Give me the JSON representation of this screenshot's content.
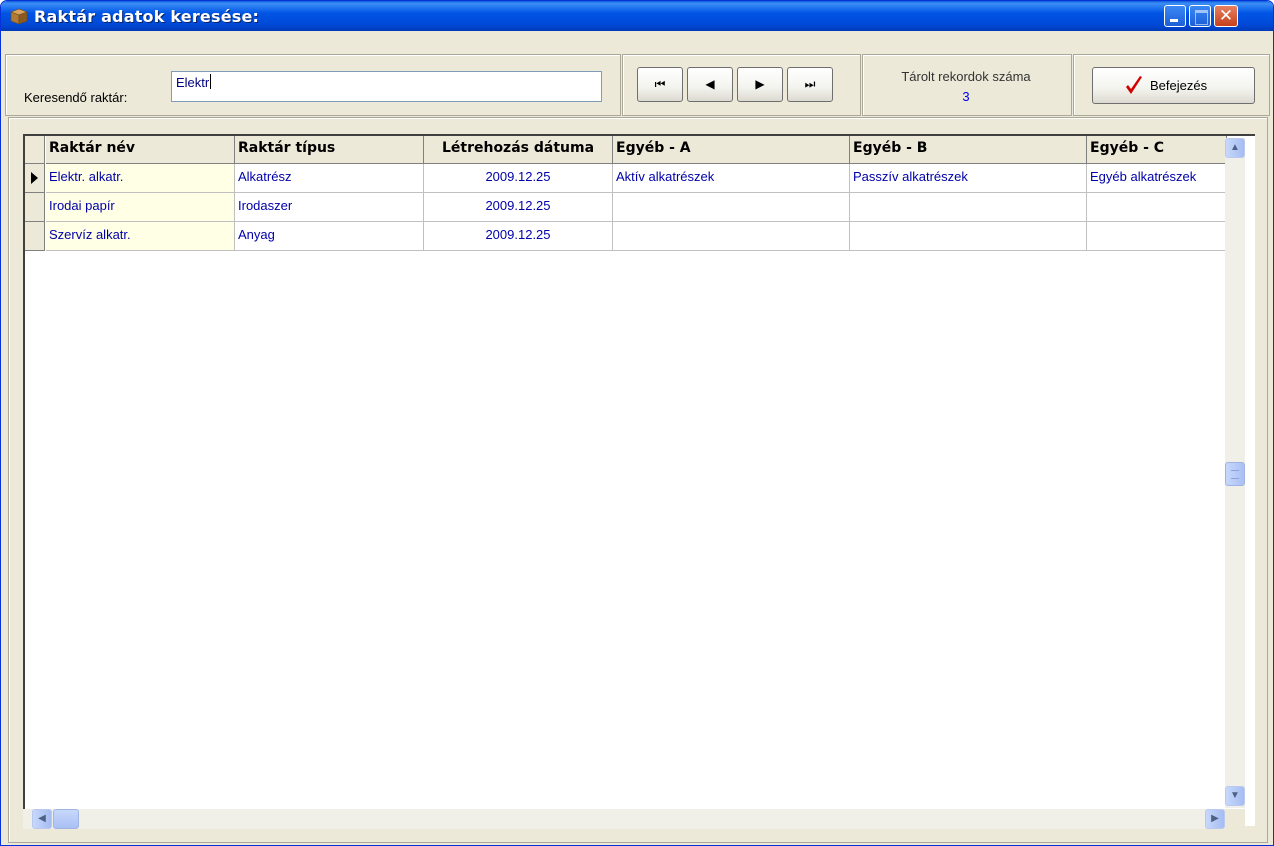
{
  "window": {
    "title": "Raktár adatok keresése:",
    "icon": "box-icon"
  },
  "search": {
    "label": "Keresendő raktár:",
    "value": "Elektr"
  },
  "nav": {
    "first_label": "⏮",
    "prev_label": "◀",
    "next_label": "▶",
    "last_label": "⏭"
  },
  "count": {
    "label": "Tárolt rekordok száma",
    "value": "3"
  },
  "exit": {
    "label": "Befejezés",
    "icon": "checkmark-icon"
  },
  "grid": {
    "columns": [
      "Raktár név",
      "Raktár típus",
      "Létrehozás dátuma",
      "Egyéb - A",
      "Egyéb - B",
      "Egyéb - C"
    ],
    "rows": [
      [
        "Elektr. alkatr.",
        "Alkatrész",
        "2009.12.25",
        "Aktív alkatrészek",
        "Passzív alkatrészek",
        "Egyéb alkatrészek"
      ],
      [
        "Irodai papír",
        "Irodaszer",
        "2009.12.25",
        "",
        "",
        ""
      ],
      [
        "Szervíz alkatr.",
        "Anyag",
        "2009.12.25",
        "",
        "",
        ""
      ]
    ]
  },
  "colors": {
    "titlebar": "#0055e5",
    "cell_text": "#0000aa",
    "name_cell_bg": "#ffffe6",
    "check": "#d40000"
  }
}
